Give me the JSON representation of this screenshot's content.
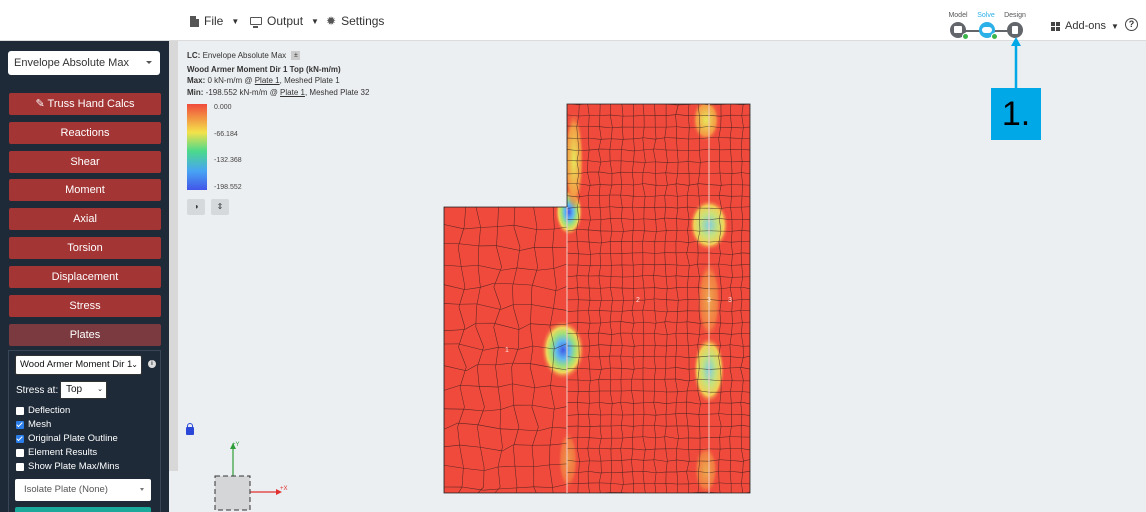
{
  "topbar": {
    "menus": [
      {
        "label": "File",
        "icon": "file-icon"
      },
      {
        "label": "Output",
        "icon": "monitor-icon"
      },
      {
        "label": "Settings",
        "icon": "gear-icon"
      }
    ],
    "workflow": [
      {
        "label": "Model",
        "state": "done"
      },
      {
        "label": "Solve",
        "state": "done",
        "color": "#2bb0e8"
      },
      {
        "label": "Design",
        "state": "pending"
      }
    ],
    "addons_label": "Add-ons",
    "help_symbol": "?"
  },
  "sidebar": {
    "load_case_select": "Envelope Absolute Max",
    "buttons": [
      "Truss Hand Calcs",
      "Reactions",
      "Shear",
      "Moment",
      "Axial",
      "Torsion",
      "Displacement",
      "Stress",
      "Plates"
    ],
    "active_button": "Plates",
    "plates": {
      "result_select": "Wood Armer Moment Dir 1",
      "stress_at_label": "Stress at:",
      "stress_at_value": "Top",
      "options": [
        {
          "label": "Deflection",
          "checked": false
        },
        {
          "label": "Mesh",
          "checked": true
        },
        {
          "label": "Original Plate Outline",
          "checked": true
        },
        {
          "label": "Element Results",
          "checked": false
        },
        {
          "label": "Show Plate Max/Mins",
          "checked": false
        }
      ],
      "isolate_select": "Isolate Plate (None)"
    }
  },
  "results_info": {
    "lc_prefix": "LC:",
    "lc_value": "Envelope Absolute Max",
    "title": "Wood Armer Moment Dir 1 Top (kN-m/m)",
    "max_prefix": "Max:",
    "max_value": "0 kN-m/m @",
    "max_plate": "Plate 1",
    "max_suffix": ", Meshed Plate 1",
    "min_prefix": "Min:",
    "min_value": "-198.552 kN-m/m @",
    "min_plate": "Plate 1",
    "min_suffix": ", Meshed Plate 32"
  },
  "legend": {
    "labels": [
      "0.000",
      "-66.184",
      "-132.368",
      "-198.552"
    ]
  },
  "viewport": {
    "plate_labels": [
      "1",
      "2",
      "3",
      "3"
    ],
    "axis_y": "+Y",
    "axis_x": "+X"
  },
  "callout": {
    "label": "1.",
    "color": "#00a8e8"
  }
}
